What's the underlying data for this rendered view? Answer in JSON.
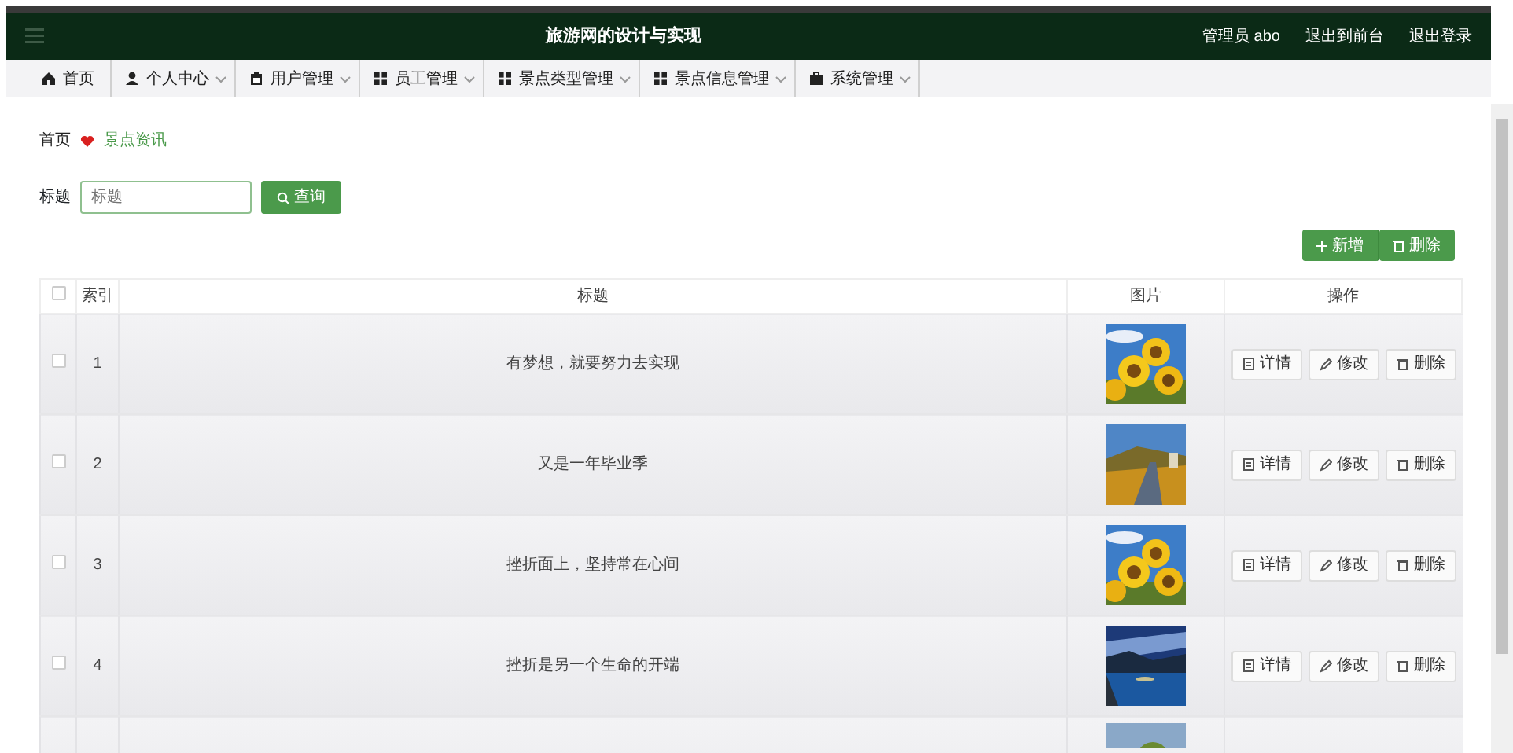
{
  "header": {
    "title": "旅游网的设计与实现",
    "user": "管理员 abo",
    "links": [
      "退出到前台",
      "退出登录"
    ]
  },
  "menu": [
    {
      "label": "首页",
      "dropdown": false
    },
    {
      "label": "个人中心",
      "dropdown": true
    },
    {
      "label": "用户管理",
      "dropdown": true
    },
    {
      "label": "员工管理",
      "dropdown": true
    },
    {
      "label": "景点类型管理",
      "dropdown": true
    },
    {
      "label": "景点信息管理",
      "dropdown": true
    },
    {
      "label": "系统管理",
      "dropdown": true
    }
  ],
  "breadcrumb": [
    {
      "label": "首页",
      "current": false
    },
    {
      "label": "景点资讯",
      "current": true
    }
  ],
  "search": {
    "label": "标题",
    "placeholder": "标题",
    "button": "查询"
  },
  "toolbar": [
    "新增",
    "删除"
  ],
  "table": {
    "select_all_checked": false,
    "columns": [
      "索引",
      "标题",
      "图片",
      "操作"
    ],
    "rows": [
      {
        "checked": false,
        "index": "1",
        "title": "有梦想，就要努力去实现",
        "picture": {
          "kind": "picture"
        },
        "actions": [
          "详情",
          "修改",
          "删除"
        ]
      },
      {
        "checked": false,
        "index": "2",
        "title": "又是一年毕业季",
        "picture": {
          "kind": "picture"
        },
        "actions": [
          "详情",
          "修改",
          "删除"
        ]
      },
      {
        "checked": false,
        "index": "3",
        "title": "挫折面上，坚持常在心间",
        "picture": {
          "kind": "picture"
        },
        "actions": [
          "详情",
          "修改",
          "删除"
        ]
      },
      {
        "checked": false,
        "index": "4",
        "title": "挫折是另一个生命的开端",
        "picture": {
          "kind": "picture"
        },
        "actions": [
          "详情",
          "修改",
          "删除"
        ]
      }
    ],
    "partial_row": {
      "picture": {
        "kind": "picture"
      }
    }
  }
}
